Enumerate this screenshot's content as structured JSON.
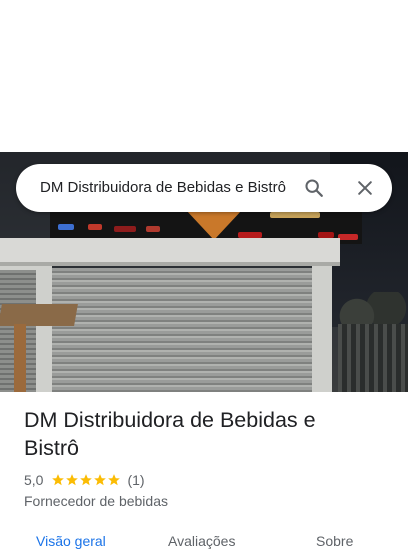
{
  "search": {
    "query": "DM Distribuidora de Bebidas e Bistrô",
    "search_icon": "search-icon",
    "close_icon": "close-icon"
  },
  "place": {
    "name": "DM Distribuidora de Bebidas e Bistrô",
    "rating": "5,0",
    "stars": 5,
    "review_count": "(1)",
    "category": "Fornecedor de bebidas"
  },
  "tabs": [
    {
      "label": "Visão geral",
      "active": true
    },
    {
      "label": "Avaliações",
      "active": false
    },
    {
      "label": "Sobre",
      "active": false
    }
  ],
  "colors": {
    "accent": "#1a73e8",
    "star": "#fbbc04",
    "text_primary": "#202124",
    "text_secondary": "#5f6368"
  }
}
